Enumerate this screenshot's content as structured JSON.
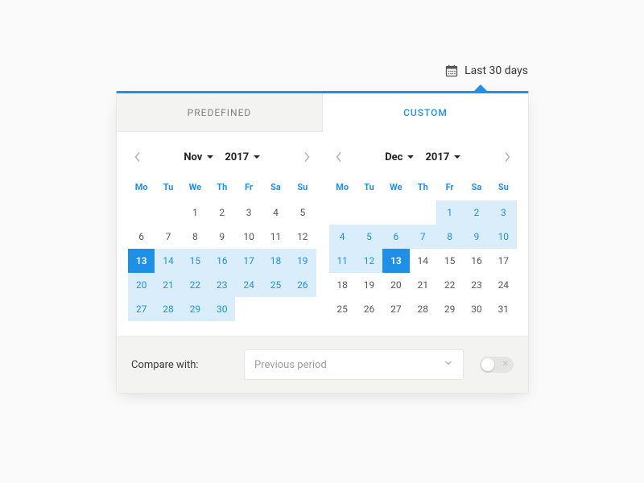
{
  "trigger": {
    "label": "Last 30 days"
  },
  "tabs": {
    "predefined": "PREDEFINED",
    "custom": "CUSTOM"
  },
  "dow": [
    "Mo",
    "Tu",
    "We",
    "Th",
    "Fr",
    "Sa",
    "Su"
  ],
  "calendars": [
    {
      "month": "Nov",
      "year": "2017",
      "weeks": [
        [
          {
            "n": ""
          },
          {
            "n": ""
          },
          {
            "n": "1"
          },
          {
            "n": "2"
          },
          {
            "n": "3"
          },
          {
            "n": "4"
          },
          {
            "n": "5"
          }
        ],
        [
          {
            "n": "6"
          },
          {
            "n": "7"
          },
          {
            "n": "8"
          },
          {
            "n": "9"
          },
          {
            "n": "10"
          },
          {
            "n": "11"
          },
          {
            "n": "12"
          }
        ],
        [
          {
            "n": "13",
            "s": "selected"
          },
          {
            "n": "14",
            "s": "in-range"
          },
          {
            "n": "15",
            "s": "in-range"
          },
          {
            "n": "16",
            "s": "in-range"
          },
          {
            "n": "17",
            "s": "in-range"
          },
          {
            "n": "18",
            "s": "in-range"
          },
          {
            "n": "19",
            "s": "in-range"
          }
        ],
        [
          {
            "n": "20",
            "s": "in-range"
          },
          {
            "n": "21",
            "s": "in-range"
          },
          {
            "n": "22",
            "s": "in-range"
          },
          {
            "n": "23",
            "s": "in-range"
          },
          {
            "n": "24",
            "s": "in-range"
          },
          {
            "n": "25",
            "s": "in-range"
          },
          {
            "n": "26",
            "s": "in-range"
          }
        ],
        [
          {
            "n": "27",
            "s": "in-range"
          },
          {
            "n": "28",
            "s": "in-range"
          },
          {
            "n": "29",
            "s": "in-range"
          },
          {
            "n": "30",
            "s": "in-range"
          },
          {
            "n": ""
          },
          {
            "n": ""
          },
          {
            "n": ""
          }
        ]
      ]
    },
    {
      "month": "Dec",
      "year": "2017",
      "weeks": [
        [
          {
            "n": ""
          },
          {
            "n": ""
          },
          {
            "n": ""
          },
          {
            "n": ""
          },
          {
            "n": "1",
            "s": "in-range"
          },
          {
            "n": "2",
            "s": "in-range"
          },
          {
            "n": "3",
            "s": "in-range"
          }
        ],
        [
          {
            "n": "4",
            "s": "in-range"
          },
          {
            "n": "5",
            "s": "in-range"
          },
          {
            "n": "6",
            "s": "in-range"
          },
          {
            "n": "7",
            "s": "in-range"
          },
          {
            "n": "8",
            "s": "in-range"
          },
          {
            "n": "9",
            "s": "in-range"
          },
          {
            "n": "10",
            "s": "in-range"
          }
        ],
        [
          {
            "n": "11",
            "s": "in-range"
          },
          {
            "n": "12",
            "s": "in-range"
          },
          {
            "n": "13",
            "s": "selected"
          },
          {
            "n": "14"
          },
          {
            "n": "15"
          },
          {
            "n": "16"
          },
          {
            "n": "17"
          }
        ],
        [
          {
            "n": "18"
          },
          {
            "n": "19"
          },
          {
            "n": "20"
          },
          {
            "n": "21"
          },
          {
            "n": "22"
          },
          {
            "n": "23"
          },
          {
            "n": "24"
          }
        ],
        [
          {
            "n": "25"
          },
          {
            "n": "26"
          },
          {
            "n": "27"
          },
          {
            "n": "28"
          },
          {
            "n": "29"
          },
          {
            "n": "30"
          },
          {
            "n": "31"
          }
        ]
      ]
    }
  ],
  "footer": {
    "label": "Compare with:",
    "dropdown_value": "Previous period",
    "toggle_on": false
  }
}
